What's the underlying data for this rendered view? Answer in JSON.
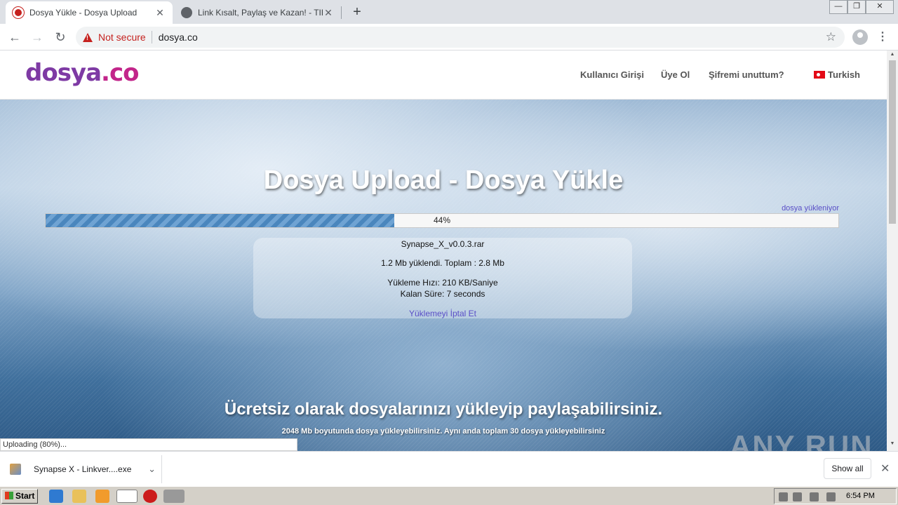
{
  "browser": {
    "tabs": [
      {
        "title": "Dosya Yükle - Dosya Upload",
        "active": true
      },
      {
        "title": "Link Kısalt, Paylaş ve Kazan! - TIK.LA",
        "active": false
      }
    ],
    "new_tab": "+",
    "close_glyph": "✕",
    "window_controls": {
      "minimize": "—",
      "restore": "❐",
      "close": "✕"
    },
    "nav": {
      "back": "←",
      "forward": "→",
      "reload": "↻"
    },
    "security_label": "Not secure",
    "url": "dosya.co",
    "bookmark_icon": "☆",
    "menu_icon": "⋮"
  },
  "site": {
    "logo_part1": "dosya",
    "logo_part2": ".co",
    "nav": {
      "login": "Kullanıcı Girişi",
      "register": "Üye Ol",
      "forgot": "Şifremi unuttum?",
      "language": "Turkish"
    },
    "hero_title": "Dosya Upload - Dosya Yükle",
    "upload_status": "dosya yükleniyor",
    "progress": {
      "percent": 44,
      "label": "44%"
    },
    "file": {
      "name": "Synapse_X_v0.0.3.rar",
      "uploaded_line": "1.2 Mb yüklendi. Toplam : 2.8 Mb",
      "speed_line": "Yükleme Hızı: 210 KB/Saniye",
      "remaining_line": "Kalan Süre: 7 seconds",
      "cancel": "Yüklemeyi İptal Et"
    },
    "tagline": "Ücretsiz olarak dosyalarınızı yükleyip paylaşabilirsiniz.",
    "subtagline": "2048 Mb boyutunda dosya yükleyebilirsiniz. Aynı anda toplam 30 dosya yükleyebilirsiniz"
  },
  "status_bar": "Uploading (80%)...",
  "watermark": "ANY RUN",
  "downloads": {
    "item_name": "Synapse X - Linkver....exe",
    "show_all": "Show all",
    "chevron": "⌄",
    "close": "✕"
  },
  "taskbar": {
    "start": "Start",
    "clock": "6:54 PM"
  },
  "colors": {
    "accent_purple": "#7e3aa4",
    "accent_pink": "#c2258a",
    "warning_red": "#c5221f",
    "progress_blue": "#4a86bd",
    "link_violet": "#5a4fc7"
  }
}
